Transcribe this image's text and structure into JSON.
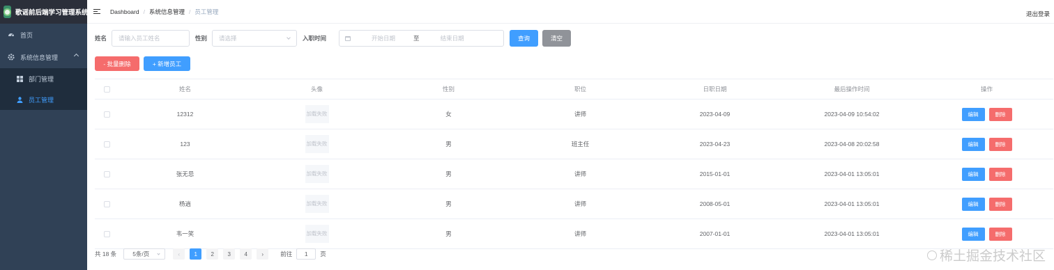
{
  "app": {
    "title": "歌谣前后端学习管理系统"
  },
  "sidebar": {
    "items": [
      {
        "label": "首页"
      },
      {
        "label": "系统信息管理"
      }
    ],
    "sub_items": [
      {
        "label": "部门管理"
      },
      {
        "label": "员工管理"
      }
    ]
  },
  "navbar": {
    "breadcrumb": [
      "Dashboard",
      "系统信息管理",
      "员工管理"
    ],
    "separator": "/",
    "logout": "退出登录"
  },
  "search": {
    "name_label": "姓名",
    "name_placeholder": "请输入员工姓名",
    "gender_label": "性别",
    "gender_placeholder": "请选择",
    "date_label": "入职时间",
    "start_placeholder": "开始日期",
    "range_sep": "至",
    "end_placeholder": "结束日期",
    "query_btn": "查询",
    "clear_btn": "清空"
  },
  "toolbar": {
    "batch_delete": "- 批量删除",
    "add_employee": "+ 新增员工"
  },
  "table": {
    "columns": [
      "姓名",
      "头像",
      "性别",
      "职位",
      "日职日期",
      "最后操作时间",
      "操作"
    ],
    "img_fail_text": "加载失败",
    "edit_label": "编辑",
    "delete_label": "删除",
    "rows": [
      {
        "name": "12312",
        "gender": "女",
        "job": "讲师",
        "entry_date": "2023-04-09",
        "update_time": "2023-04-09 10:54:02"
      },
      {
        "name": "123",
        "gender": "男",
        "job": "班主任",
        "entry_date": "2023-04-23",
        "update_time": "2023-04-08 20:02:58"
      },
      {
        "name": "张无忌",
        "gender": "男",
        "job": "讲师",
        "entry_date": "2015-01-01",
        "update_time": "2023-04-01 13:05:01"
      },
      {
        "name": "杨逍",
        "gender": "男",
        "job": "讲师",
        "entry_date": "2008-05-01",
        "update_time": "2023-04-01 13:05:01"
      },
      {
        "name": "韦一笑",
        "gender": "男",
        "job": "讲师",
        "entry_date": "2007-01-01",
        "update_time": "2023-04-01 13:05:01"
      }
    ]
  },
  "pagination": {
    "total": "共 18 条",
    "page_size": "5条/页",
    "prev": "‹",
    "next": "›",
    "pages": [
      "1",
      "2",
      "3",
      "4"
    ],
    "goto_label": "前往",
    "goto_value": "1",
    "page_unit": "页"
  },
  "watermark": "稀土掘金技术社区",
  "colors": {
    "sidebar_bg": "#304156",
    "sidebar_sub_bg": "#1f2d3d",
    "primary": "#409eff",
    "danger": "#f56c6c",
    "info": "#909399"
  }
}
